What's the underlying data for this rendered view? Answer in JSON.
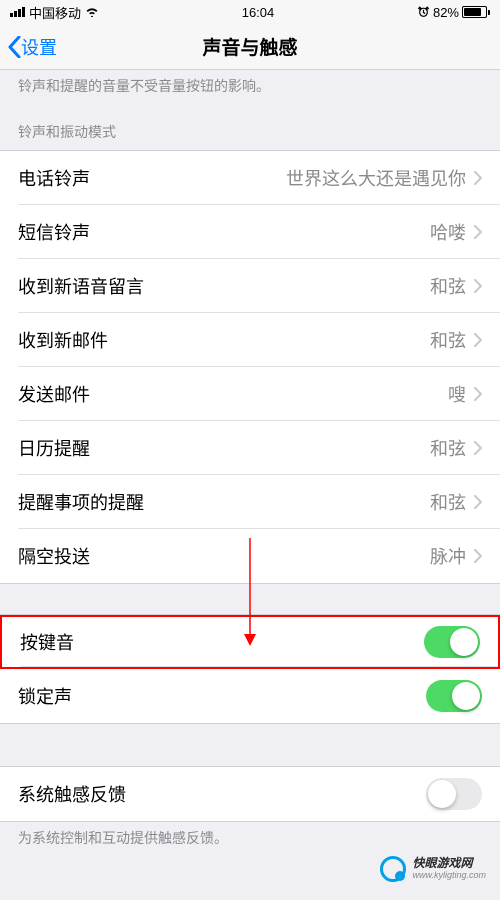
{
  "status": {
    "carrier": "中国移动",
    "time": "16:04",
    "battery_pct": "82%"
  },
  "nav": {
    "back": "设置",
    "title": "声音与触感"
  },
  "top_note": "铃声和提醒的音量不受音量按钮的影响。",
  "group1_header": "铃声和振动模式",
  "rows": [
    {
      "label": "电话铃声",
      "value": "世界这么大还是遇见你"
    },
    {
      "label": "短信铃声",
      "value": "哈喽"
    },
    {
      "label": "收到新语音留言",
      "value": "和弦"
    },
    {
      "label": "收到新邮件",
      "value": "和弦"
    },
    {
      "label": "发送邮件",
      "value": "嗖"
    },
    {
      "label": "日历提醒",
      "value": "和弦"
    },
    {
      "label": "提醒事项的提醒",
      "value": "和弦"
    },
    {
      "label": "隔空投送",
      "value": "脉冲"
    }
  ],
  "toggles": {
    "keyclick": "按键音",
    "lock": "锁定声"
  },
  "haptic": {
    "label": "系统触感反馈",
    "note": "为系统控制和互动提供触感反馈。"
  },
  "watermark": {
    "main": "快眼游戏网",
    "sub": "www.kyligting.com"
  }
}
